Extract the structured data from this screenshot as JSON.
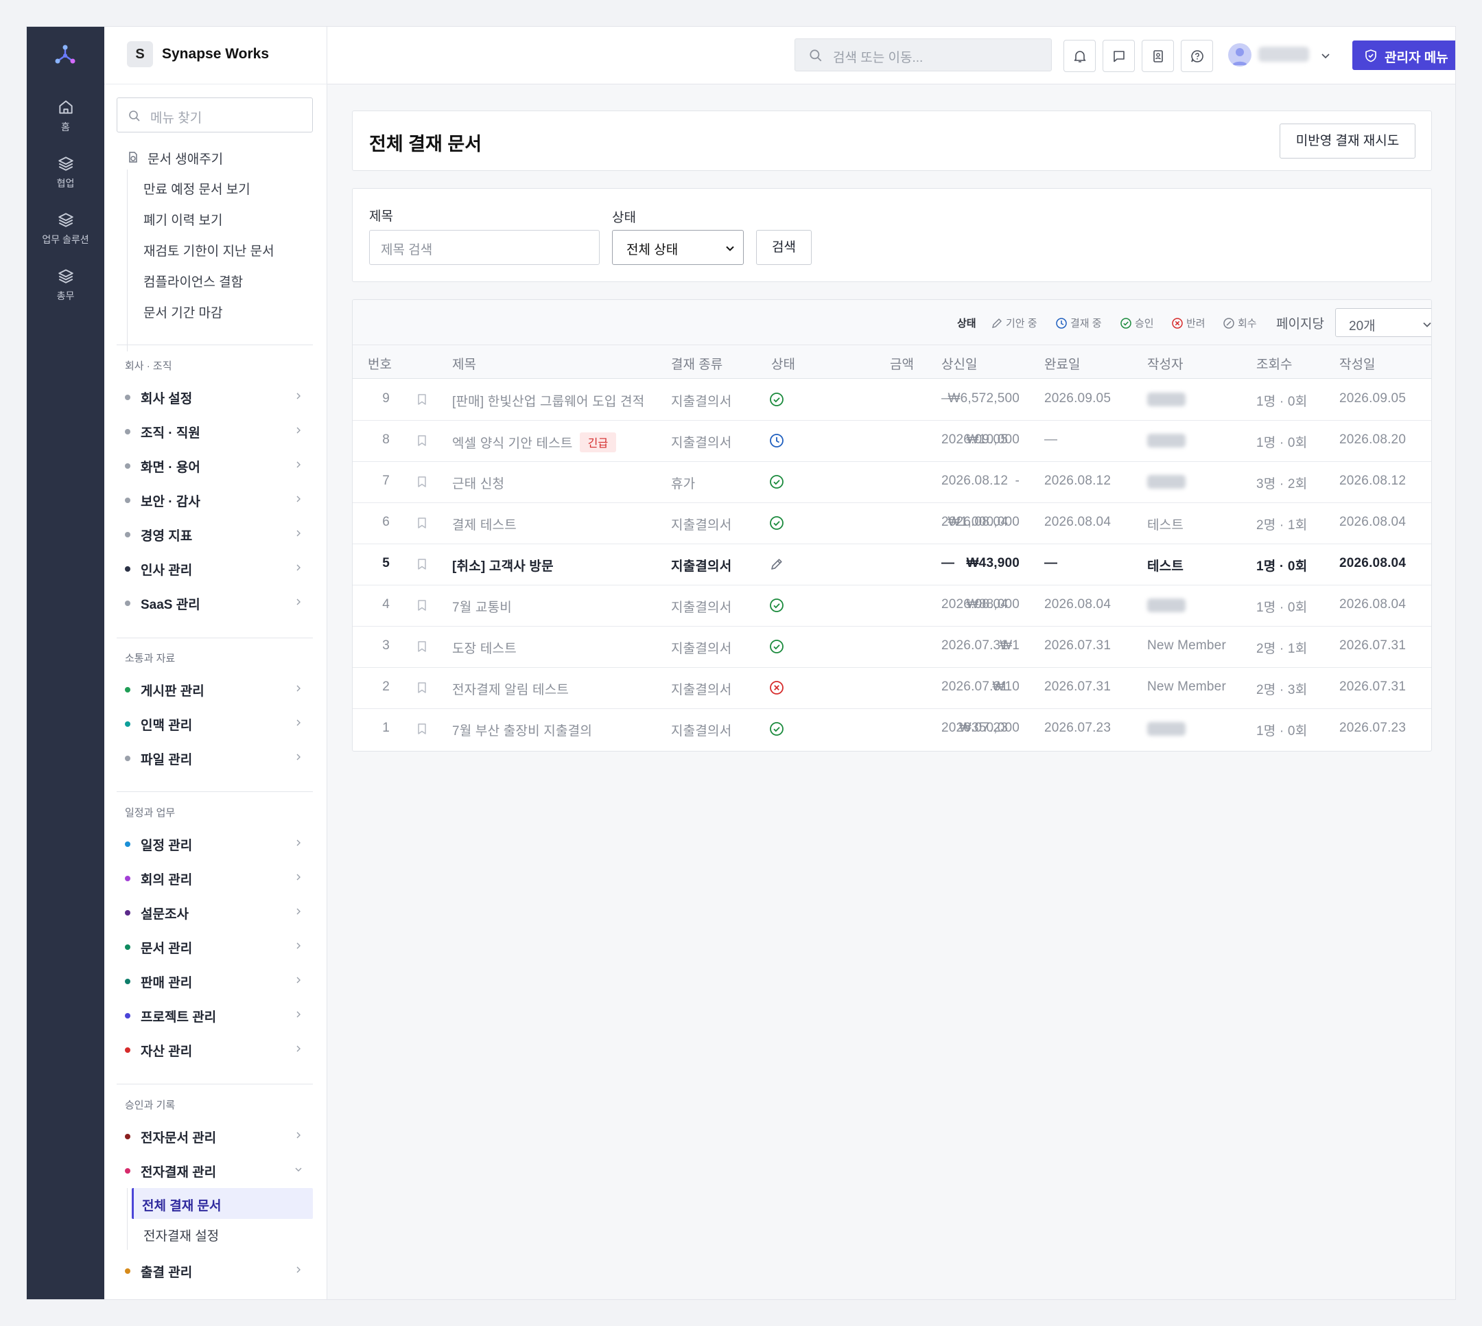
{
  "rail": {
    "items": [
      {
        "label": "홈",
        "icon": "home-icon"
      },
      {
        "label": "협업",
        "icon": "layers-icon"
      },
      {
        "label": "업무 솔루션",
        "icon": "layers-icon"
      },
      {
        "label": "총무",
        "icon": "layers-icon"
      }
    ]
  },
  "brand": {
    "badge": "S",
    "name": "Synapse Works"
  },
  "topbar": {
    "search_placeholder": "검색 또는 이동...",
    "admin_label": "관리자 메뉴"
  },
  "sidebar": {
    "search_placeholder": "메뉴 찾기",
    "lifecycle": {
      "title": "문서 생애주기",
      "links": [
        "만료 예정 문서 보기",
        "폐기 이력 보기",
        "재검토 기한이 지난 문서",
        "컴플라이언스 결함",
        "문서 기간 마감"
      ]
    },
    "sections": [
      {
        "title": "회사 · 조직",
        "items": [
          {
            "label": "회사 설정",
            "dot": "#9aa0aa"
          },
          {
            "label": "조직 · 직원",
            "dot": "#9aa0aa"
          },
          {
            "label": "화면 · 용어",
            "dot": "#9aa0aa"
          },
          {
            "label": "보안 · 감사",
            "dot": "#9aa0aa"
          },
          {
            "label": "경영 지표",
            "dot": "#9aa0aa"
          },
          {
            "label": "인사 관리",
            "dot": "#2b3245"
          },
          {
            "label": "SaaS 관리",
            "dot": "#9aa0aa"
          }
        ]
      },
      {
        "title": "소통과 자료",
        "items": [
          {
            "label": "게시판 관리",
            "dot": "#1f9d55"
          },
          {
            "label": "인맥 관리",
            "dot": "#0e9f9a"
          },
          {
            "label": "파일 관리",
            "dot": "#9aa0aa"
          }
        ]
      },
      {
        "title": "일정과 업무",
        "items": [
          {
            "label": "일정 관리",
            "dot": "#1a8fd6"
          },
          {
            "label": "회의 관리",
            "dot": "#a23fd6"
          },
          {
            "label": "설문조사",
            "dot": "#5b2a8a"
          },
          {
            "label": "문서 관리",
            "dot": "#0f8a5f"
          },
          {
            "label": "판매 관리",
            "dot": "#0e7d6a"
          },
          {
            "label": "프로젝트 관리",
            "dot": "#4b45d8"
          },
          {
            "label": "자산 관리",
            "dot": "#d62b2b"
          }
        ]
      },
      {
        "title": "승인과 기록",
        "items": [
          {
            "label": "전자문서 관리",
            "dot": "#8a1f1f"
          },
          {
            "label": "전자결재 관리",
            "dot": "#d62b6b"
          },
          {
            "label": "출결 관리",
            "dot": "#d68a1a"
          }
        ]
      }
    ],
    "approval_sub": {
      "active": "전체 결재 문서",
      "other": "전자결재 설정"
    }
  },
  "page": {
    "title": "전체 결재 문서",
    "retry_button": "미반영 결재 재시도"
  },
  "filters": {
    "title_label": "제목",
    "title_placeholder": "제목 검색",
    "status_label": "상태",
    "status_value": "전체 상태",
    "search_button": "검색"
  },
  "legend": {
    "label": "상태",
    "items": [
      {
        "label": "기안 중",
        "icon": "pencil-icon"
      },
      {
        "label": "결재 중",
        "icon": "clock-icon"
      },
      {
        "label": "승인",
        "icon": "check-circle-icon"
      },
      {
        "label": "반려",
        "icon": "x-circle-icon"
      },
      {
        "label": "회수",
        "icon": "slash-circle-icon"
      }
    ],
    "per_page_label": "페이지당",
    "per_page_value": "20개"
  },
  "table": {
    "columns": [
      "번호",
      "제목",
      "결재 종류",
      "상태",
      "금액",
      "상신일",
      "완료일",
      "작성자",
      "조회수",
      "작성일"
    ],
    "rows": [
      {
        "no": "9",
        "title": "[판매] 한빛산업 그룹웨어 도입 견적",
        "urgent": "",
        "type": "지출결의서",
        "status": "approved",
        "amount": "₩6,572,500",
        "submitted": "—",
        "completed": "2026.09.05",
        "author": "",
        "views": "1명 · 0회",
        "created": "2026.09.05",
        "bold": false
      },
      {
        "no": "8",
        "title": "엑셀 양식 기안 테스트",
        "urgent": "긴급",
        "type": "지출결의서",
        "status": "in_progress",
        "amount": "₩10,000",
        "submitted": "2026.09.05",
        "completed": "—",
        "author": "",
        "views": "1명 · 0회",
        "created": "2026.08.20",
        "bold": false
      },
      {
        "no": "7",
        "title": "근태 신청",
        "urgent": "",
        "type": "휴가",
        "status": "approved",
        "amount": "-",
        "submitted": "2026.08.12",
        "completed": "2026.08.12",
        "author": "",
        "views": "3명 · 2회",
        "created": "2026.08.12",
        "bold": false
      },
      {
        "no": "6",
        "title": "결제 테스트",
        "urgent": "",
        "type": "지출결의서",
        "status": "approved",
        "amount": "₩1,000,000",
        "submitted": "2026.08.04",
        "completed": "2026.08.04",
        "author": "테스트",
        "views": "2명 · 1회",
        "created": "2026.08.04",
        "bold": false
      },
      {
        "no": "5",
        "title": "[취소] 고객사 방문",
        "urgent": "",
        "type": "지출결의서",
        "status": "draft",
        "amount": "₩43,900",
        "submitted": "—",
        "completed": "—",
        "author": "테스트",
        "views": "1명 · 0회",
        "created": "2026.08.04",
        "bold": true
      },
      {
        "no": "4",
        "title": "7월 교통비",
        "urgent": "",
        "type": "지출결의서",
        "status": "approved",
        "amount": "₩88,000",
        "submitted": "2026.08.04",
        "completed": "2026.08.04",
        "author": "",
        "views": "1명 · 0회",
        "created": "2026.08.04",
        "bold": false
      },
      {
        "no": "3",
        "title": "도장 테스트",
        "urgent": "",
        "type": "지출결의서",
        "status": "approved",
        "amount": "₩1",
        "submitted": "2026.07.31",
        "completed": "2026.07.31",
        "author": "New Member",
        "views": "2명 · 1회",
        "created": "2026.07.31",
        "bold": false
      },
      {
        "no": "2",
        "title": "전자결제 알림 테스트",
        "urgent": "",
        "type": "지출결의서",
        "status": "rejected",
        "amount": "₩10",
        "submitted": "2026.07.31",
        "completed": "2026.07.31",
        "author": "New Member",
        "views": "2명 · 3회",
        "created": "2026.07.31",
        "bold": false
      },
      {
        "no": "1",
        "title": "7월 부산 출장비 지출결의",
        "urgent": "",
        "type": "지출결의서",
        "status": "approved",
        "amount": "₩350,000",
        "submitted": "2026.07.23",
        "completed": "2026.07.23",
        "author": "",
        "views": "1명 · 0회",
        "created": "2026.07.23",
        "bold": false
      }
    ]
  },
  "colors": {
    "accent": "#4b45d8",
    "approved": "#1a8a3c",
    "in_progress": "#1f5fbf",
    "rejected": "#d62b2b",
    "rail": "#2b3245"
  }
}
